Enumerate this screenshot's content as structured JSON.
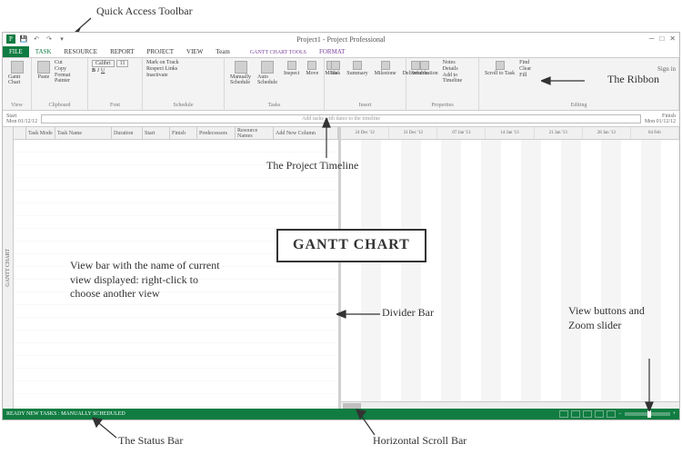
{
  "annotations": {
    "qat": "Quick Access Toolbar",
    "ribbon": "The Ribbon",
    "timeline": "The Project Timeline",
    "viewbar": "View bar with the name of current view displayed: right-click to choose another view",
    "center_label": "GANTT CHART",
    "divider": "Divider Bar",
    "viewzoom": "View buttons and Zoom slider",
    "status": "The Status Bar",
    "hscroll": "Horizontal Scroll Bar"
  },
  "window": {
    "title": "Project1 - Project Professional",
    "signin": "Sign in"
  },
  "tabs": {
    "file": "FILE",
    "task": "TASK",
    "resource": "RESOURCE",
    "report": "REPORT",
    "project": "PROJECT",
    "view": "VIEW",
    "team": "Team",
    "contextual_header": "GANTT CHART TOOLS",
    "format": "FORMAT"
  },
  "ribbon": {
    "view": {
      "gantt": "Gantt Chart",
      "label": "View"
    },
    "clipboard": {
      "paste": "Paste",
      "cut": "Cut",
      "copy": "Copy",
      "fmt": "Format Painter",
      "label": "Clipboard"
    },
    "font": {
      "family": "Calibri",
      "size": "11",
      "label": "Font"
    },
    "schedule": {
      "markontrack": "Mark on Track",
      "respect": "Respect Links",
      "inactivate": "Inactivate",
      "label": "Schedule"
    },
    "tasks": {
      "manual": "Manually Schedule",
      "auto": "Auto Schedule",
      "inspect": "Inspect",
      "move": "Move",
      "mode": "Mode",
      "label": "Tasks"
    },
    "insert": {
      "task": "Task",
      "summary": "Summary",
      "milestone": "Milestone",
      "deliv": "Deliverable",
      "label": "Insert"
    },
    "properties": {
      "info": "Information",
      "details": "Details",
      "notes": "Notes",
      "addtl": "Add to Timeline",
      "label": "Properties"
    },
    "editing": {
      "scroll": "Scroll to Task",
      "find": "Find",
      "clear": "Clear",
      "fill": "Fill",
      "label": "Editing"
    }
  },
  "timeline": {
    "start_label": "Start",
    "start_date": "Mon 01/12/12",
    "placeholder": "Add tasks with dates to the timeline",
    "finish_label": "Finish",
    "finish_date": "Mon 01/12/12"
  },
  "viewbar_label": "GANTT CHART",
  "columns": [
    "",
    "Task Mode",
    "Task Name",
    "Duration",
    "Start",
    "Finish",
    "Predecessors",
    "Resource Names",
    "Add New Column"
  ],
  "timescale": [
    "24 Dec '12",
    "31 Dec '12",
    "07 Jan '13",
    "14 Jan '13",
    "21 Jan '13",
    "28 Jan '13",
    "04 Feb"
  ],
  "status_left": "READY    NEW TASKS : MANUALLY SCHEDULED"
}
